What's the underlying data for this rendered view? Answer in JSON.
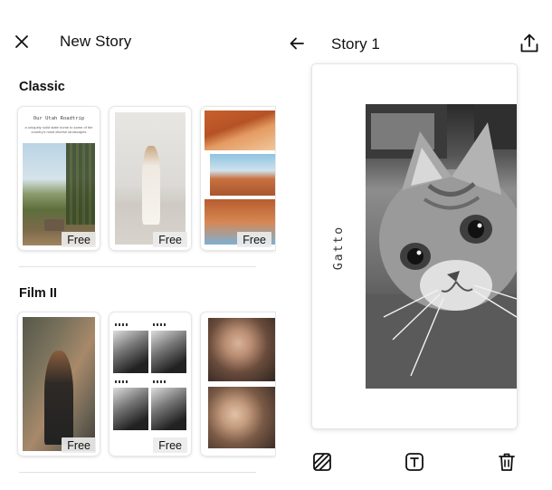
{
  "left_panel": {
    "title": "New Story",
    "close_icon": "close-icon",
    "sections": [
      {
        "title": "Classic",
        "templates": [
          {
            "id": "road-trip",
            "badge": "Free",
            "inner_title": "Our Utah Roadtrip",
            "inner_desc": "a uniquely solid state home to some of the country's most diverse landscapes"
          },
          {
            "id": "woman-stool",
            "badge": "Free"
          },
          {
            "id": "canyon-collage",
            "badge": "Free"
          }
        ]
      },
      {
        "title": "Film II",
        "templates": [
          {
            "id": "woman-tree",
            "badge": "Free"
          },
          {
            "id": "bw-grid",
            "badge": "Free"
          },
          {
            "id": "portraits"
          }
        ]
      }
    ]
  },
  "right_panel": {
    "title": "Story 1",
    "back_icon": "arrow-left-icon",
    "share_icon": "share-upload-icon",
    "canvas": {
      "label": "Gatto",
      "photo": "cat-photo"
    },
    "toolbar": [
      {
        "icon": "background-pattern-icon"
      },
      {
        "icon": "text-tool-icon"
      },
      {
        "icon": "trash-icon"
      }
    ]
  },
  "colors": {
    "background": "#ffffff",
    "text": "#111111",
    "divider": "#e2e2e2",
    "badge_bg": "#ebebeb"
  }
}
